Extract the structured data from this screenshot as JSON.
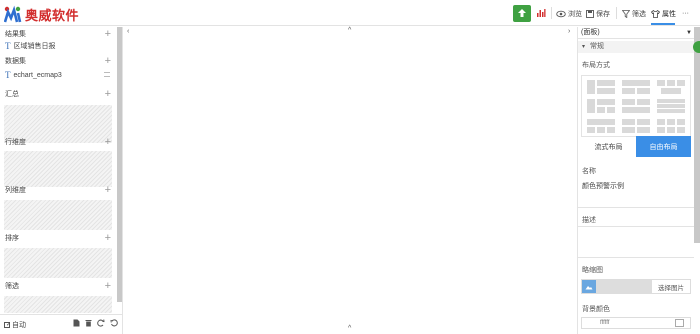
{
  "app": {
    "name": "奥威软件"
  },
  "toolbar": {
    "browse_label": "浏览",
    "save_label": "保存",
    "filter_label": "筛选",
    "property_label": "属性",
    "more_label": "···"
  },
  "left": {
    "result_set": "结果集",
    "report_item": "区域销售日报",
    "dataset": "数据集",
    "dataset_item": "echart_ecmap3",
    "summary": "汇总",
    "row_dim": "行维度",
    "col_dim": "列维度",
    "sort": "排序",
    "filter": "筛选",
    "auto_label": "自动"
  },
  "right": {
    "dropdown_value": "(面板)",
    "section_title": "常规",
    "layout_label": "布局方式",
    "tab_flow": "流式布局",
    "tab_free": "自由布局",
    "name_label": "名称",
    "name_value": "颜色预警示例",
    "desc_label": "描述",
    "thumb_label": "略缩图",
    "thumb_btn": "选择图片",
    "bgcolor_label": "背景颜色",
    "bgcolor_value": "ffffff"
  },
  "colors": {
    "accent": "#3a8ee6",
    "green": "#3fa142",
    "brand": "#d22d2d"
  }
}
